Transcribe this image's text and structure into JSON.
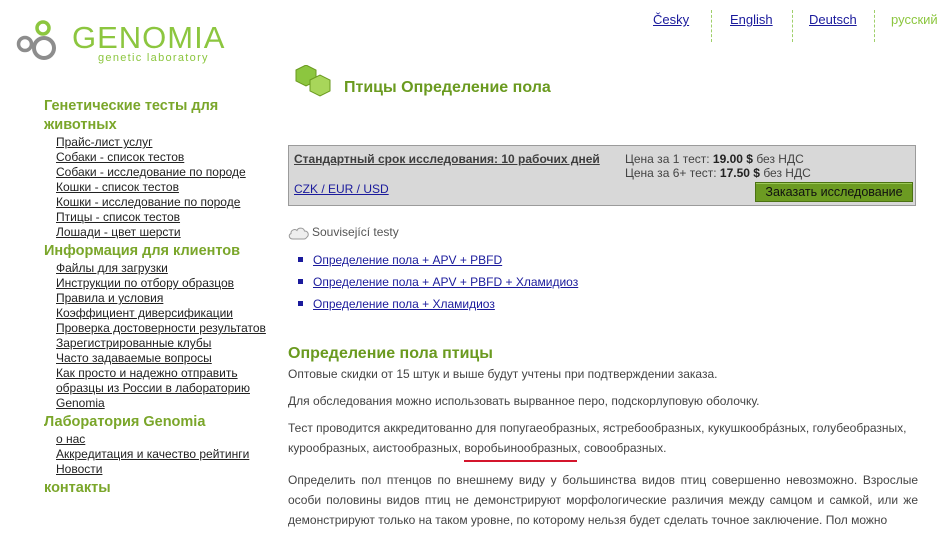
{
  "header": {
    "logo": {
      "name": "GENOMIA",
      "tagline": "genetic laboratory"
    },
    "languages": [
      {
        "label": "Česky",
        "current": false
      },
      {
        "label": "English",
        "current": false
      },
      {
        "label": "Deutsch",
        "current": false
      },
      {
        "label": "русский",
        "current": true
      }
    ]
  },
  "sidebar": {
    "groups": [
      {
        "title": "Генетические тесты для животных",
        "items": [
          "Прайс-лист услуг",
          "Собаки - список тестов",
          "Собаки - исследование по породе",
          "Кошки - список тестов",
          "Кошки - исследование по породе",
          "Птицы - список тестов",
          "Лошади - цвет шерсти"
        ]
      },
      {
        "title": "Информация для клиентов",
        "items": [
          "Файлы для загрузки",
          "Инструкции по отбору образцов",
          "Правила и условия",
          "Коэффициент диверсификации",
          "Проверка достоверности результатов",
          "Зарегистрированные клубы",
          "Часто задаваемые вопросы",
          "Как просто и надежно отправить образцы из России в лабораторию Genomia"
        ]
      },
      {
        "title": "Лаборатория Genomia",
        "items": [
          "о нас",
          "Аккредитация и качество рейтинги",
          "Новости"
        ]
      },
      {
        "title": "контакты",
        "items": []
      }
    ]
  },
  "main": {
    "page_title": "Птицы Определение пола",
    "price_box": {
      "standard_term": "Стандартный срок исследования: 10 рабочих дней",
      "currencies": "CZK / EUR / USD",
      "price_single_label": "Цена за 1 тест:",
      "price_single_value": "19.00 $",
      "price_multi_label": "Цена за 6+ тест:",
      "price_multi_value": "17.50 $",
      "vat_note": "без НДС",
      "order_button": "Заказать исследование"
    },
    "related": {
      "title": "Související testy",
      "items": [
        "Определение пола + APV + PBFD",
        "Определение пола + APV + PBFD + Хламидиоз",
        "Определение пола + Хламидиоз"
      ]
    },
    "section_title": "Определение пола птицы",
    "paragraphs": {
      "p1": "Оптовые скидки от 15 штук и выше будут учтены при подтверждении заказа.",
      "p2": "Для обследования можно использовать вырванное перо, подскорлуповую оболочку.",
      "p3_before": "Тест проводится аккредитованно для попугаеобразных, ястребообразных, кукушкообра́зных, голубеобразных, курообразных, аистообразных, ",
      "p3_highlight": "воробьинообразных",
      "p3_after": ", совообразных.",
      "p4": "Определить пол птенцов по внешнему виду у большинства видов птиц совершенно невозможно. Взрослые особи половины видов птиц не демонстрируют морфологические различия между самцом и самкой, или же демонстрируют только на таком уровне, по которому нельзя будет сделать точное заключение. Пол можно"
    },
    "colors": {
      "brand_green": "#8cc63f",
      "heading_green": "#6a9a1f",
      "link_blue": "#1a1a9c",
      "annotation_red": "#d4152c"
    }
  }
}
